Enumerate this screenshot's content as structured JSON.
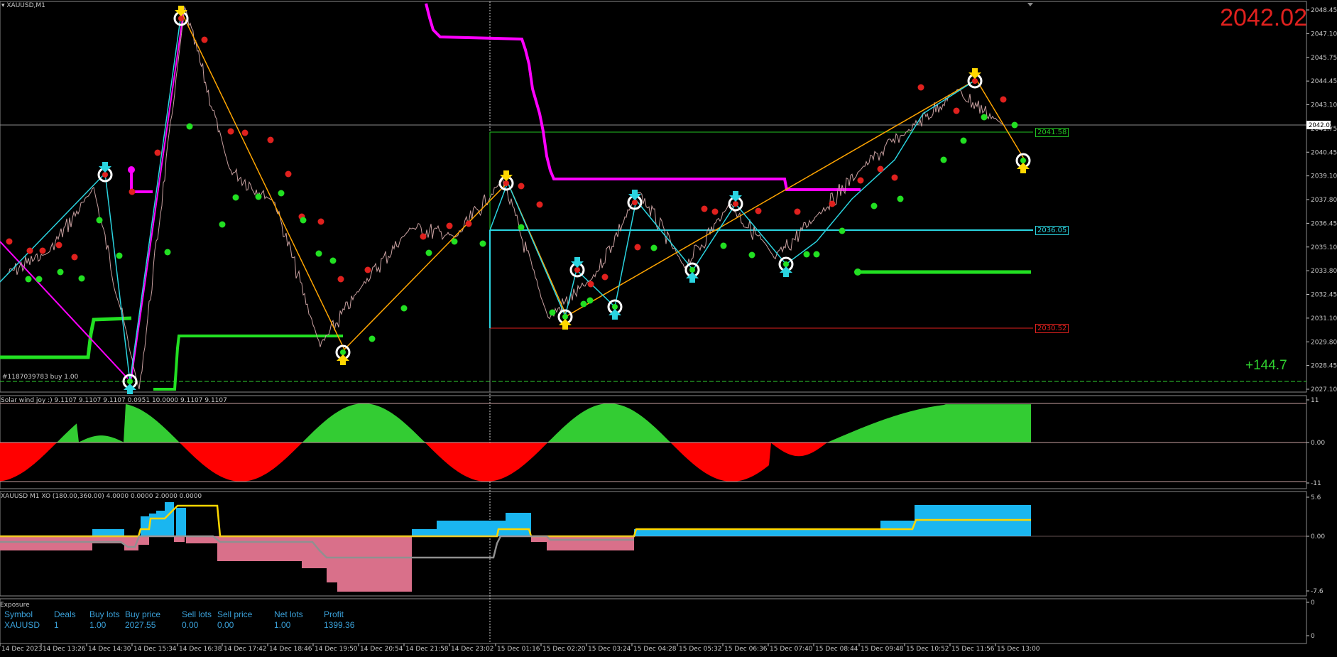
{
  "symbol_title": "XAUUSD,M1",
  "big_price": "2042.02",
  "profit_text": "+144.7",
  "order_label": "#1187039783 buy 1.00",
  "levels": {
    "green": {
      "label": "2041.58",
      "color": "#22c322"
    },
    "cyan": {
      "label": "2036.05",
      "color": "#2ad4e0"
    },
    "red": {
      "label": "2030.52",
      "color": "#e0211e"
    },
    "current": {
      "label": "2042.02"
    }
  },
  "price_axis": {
    "ticks": [
      "2048.45",
      "2047.10",
      "2045.75",
      "2044.45",
      "2043.10",
      "2041.75",
      "2040.45",
      "2039.10",
      "2037.80",
      "2036.45",
      "2035.10",
      "2033.80",
      "2032.45",
      "2031.10",
      "2029.80",
      "2028.45",
      "2027.10"
    ]
  },
  "time_axis": {
    "ticks": [
      "14 Dec 2023",
      "14 Dec 13:26",
      "14 Dec 14:30",
      "14 Dec 15:34",
      "14 Dec 16:38",
      "14 Dec 17:42",
      "14 Dec 18:46",
      "14 Dec 19:50",
      "14 Dec 20:54",
      "14 Dec 21:58",
      "14 Dec 23:02",
      "15 Dec 01:16",
      "15 Dec 02:20",
      "15 Dec 03:24",
      "15 Dec 04:28",
      "15 Dec 05:32",
      "15 Dec 06:36",
      "15 Dec 07:40",
      "15 Dec 08:44",
      "15 Dec 09:48",
      "15 Dec 10:52",
      "15 Dec 11:56",
      "15 Dec 13:00"
    ]
  },
  "indicator1": {
    "title": "Solar wind joy :) 9.1107 9.1107 9.1107 0.0951 10.0000 9.1107 9.1107",
    "axis": [
      "11",
      "0.00",
      "-11"
    ]
  },
  "indicator2": {
    "title": "XAUUSD M1 XO (180.00,360.00) 4.0000 0.0000 2.0000 0.0000",
    "axis": [
      "5.6",
      "0.00",
      "-7.6"
    ]
  },
  "exposure": {
    "title": "Exposure",
    "headers": [
      "Symbol",
      "Deals",
      "Buy lots",
      "Buy price",
      "Sell lots",
      "Sell price",
      "Net lots",
      "Profit"
    ],
    "row": [
      "XAUUSD",
      "1",
      "1.00",
      "2027.55",
      "0.00",
      "0.00",
      "1.00",
      "1399.36"
    ],
    "axis": [
      "0",
      "0"
    ]
  },
  "chart_data": {
    "type": "line",
    "title": "XAUUSD,M1",
    "ylim": [
      2026.5,
      2049.0
    ],
    "x": [
      "14 Dec 2023",
      "14 Dec 13:26",
      "14 Dec 14:30",
      "14 Dec 15:34",
      "14 Dec 16:38",
      "14 Dec 17:42",
      "14 Dec 18:46",
      "14 Dec 19:50",
      "14 Dec 20:54",
      "14 Dec 21:58",
      "14 Dec 23:02",
      "15 Dec 01:16",
      "15 Dec 02:20",
      "15 Dec 03:24",
      "15 Dec 04:28",
      "15 Dec 05:32",
      "15 Dec 06:36",
      "15 Dec 07:40",
      "15 Dec 08:44",
      "15 Dec 09:48",
      "15 Dec 10:52",
      "15 Dec 11:56",
      "15 Dec 13:00"
    ],
    "series": [
      {
        "values": [
          2033.6,
          2034.8,
          2038.4,
          2027.0,
          2048.6,
          2039.5,
          2037.6,
          2029.5,
          2033.2,
          2036.2,
          2035.7,
          2038.9,
          2031.1,
          2033.4,
          2038.2,
          2034.0,
          2037.5,
          2034.5,
          2037.1,
          2039.8,
          2041.8,
          2043.9,
          2042.02
        ]
      }
    ]
  },
  "colors": {
    "background": "#000000",
    "price": "#c8a0a0",
    "zigzag": "#ffa500",
    "magenta": "#ff00ff",
    "cyan": "#2ad4e0",
    "green": "#22e022",
    "red": "#e0211e"
  }
}
